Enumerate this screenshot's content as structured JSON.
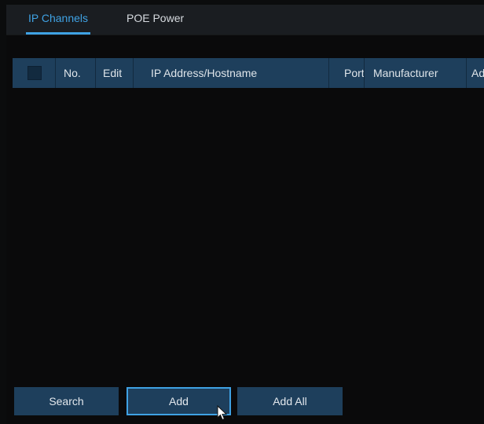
{
  "tabs": [
    {
      "label": "IP Channels",
      "active": true
    },
    {
      "label": "POE Power",
      "active": false
    }
  ],
  "table": {
    "columns": [
      {
        "label": ""
      },
      {
        "label": "No."
      },
      {
        "label": "Edit"
      },
      {
        "label": "IP Address/Hostname"
      },
      {
        "label": "Port"
      },
      {
        "label": "Manufacturer"
      },
      {
        "label": "Ad"
      }
    ],
    "rows": []
  },
  "buttons": {
    "search": "Search",
    "add": "Add",
    "add_all": "Add All"
  },
  "colors": {
    "accent": "#3fa2e4",
    "header_bg": "#1e3f5c",
    "background": "#0a0a0b"
  }
}
